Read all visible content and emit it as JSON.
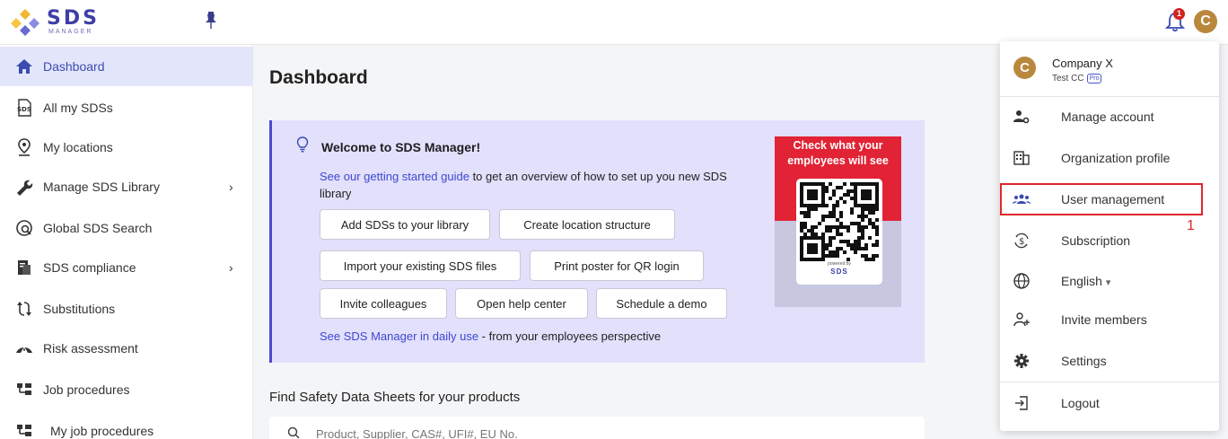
{
  "brand": {
    "name": "SDS",
    "sub": "MANAGER"
  },
  "notifications": {
    "count": "1"
  },
  "user": {
    "initial": "C"
  },
  "sidebar": {
    "items": [
      {
        "label": "Dashboard",
        "icon": "home-icon"
      },
      {
        "label": "All my SDSs",
        "icon": "sds-file-icon"
      },
      {
        "label": "My locations",
        "icon": "location-pin-icon"
      },
      {
        "label": "Manage SDS Library",
        "icon": "wrench-icon"
      },
      {
        "label": "Global SDS Search",
        "icon": "global-search-icon"
      },
      {
        "label": "SDS compliance",
        "icon": "compliance-icon"
      },
      {
        "label": "Substitutions",
        "icon": "substitution-arrows-icon"
      },
      {
        "label": "Risk assessment",
        "icon": "warning-triangle-icon"
      },
      {
        "label": "Job procedures",
        "icon": "hierarchy-icon"
      },
      {
        "label": "My job procedures",
        "icon": "hierarchy-icon"
      }
    ],
    "chevron": "›"
  },
  "main": {
    "title": "Dashboard",
    "welcome": {
      "title": "Welcome to SDS Manager!",
      "guide_link": "See our getting started guide",
      "guide_text": " to get an overview of how to set up you new SDS library",
      "buttons": {
        "add_sds": "Add SDSs to your library",
        "location": "Create location structure",
        "import": "Import your existing SDS files",
        "poster": "Print poster for QR login",
        "invite": "Invite colleagues",
        "help": "Open help center",
        "demo": "Schedule a demo"
      },
      "daily_link": "See SDS Manager in daily use",
      "daily_text": " - from your employees perspective",
      "poster": {
        "title_line1": "Check what your",
        "title_line2": "employees will see",
        "powered": "powered by",
        "logo": "SDS"
      }
    },
    "find_title": "Find Safety Data Sheets for your products",
    "search_placeholder": "Product, Supplier, CAS#, UFI#, EU No."
  },
  "account_menu": {
    "company": "Company X",
    "subtitle": "Test CC",
    "plan": "Pro",
    "items": [
      {
        "label": "Manage account",
        "icon": "user-gear-icon"
      },
      {
        "label": "Organization profile",
        "icon": "building-icon"
      },
      {
        "label": "User management",
        "icon": "users-icon"
      },
      {
        "label": "Subscription",
        "icon": "dollar-refresh-icon"
      },
      {
        "label": "English",
        "icon": "globe-icon"
      },
      {
        "label": "Invite members",
        "icon": "user-plus-icon"
      },
      {
        "label": "Settings",
        "icon": "gear-icon"
      },
      {
        "label": "Logout",
        "icon": "logout-icon"
      }
    ],
    "caret": "▾"
  },
  "annotation": "1",
  "colors": {
    "accent": "#3e48d0",
    "highlight": "#e0272b",
    "poster_red": "#e22235",
    "avatar": "#b9883c"
  }
}
